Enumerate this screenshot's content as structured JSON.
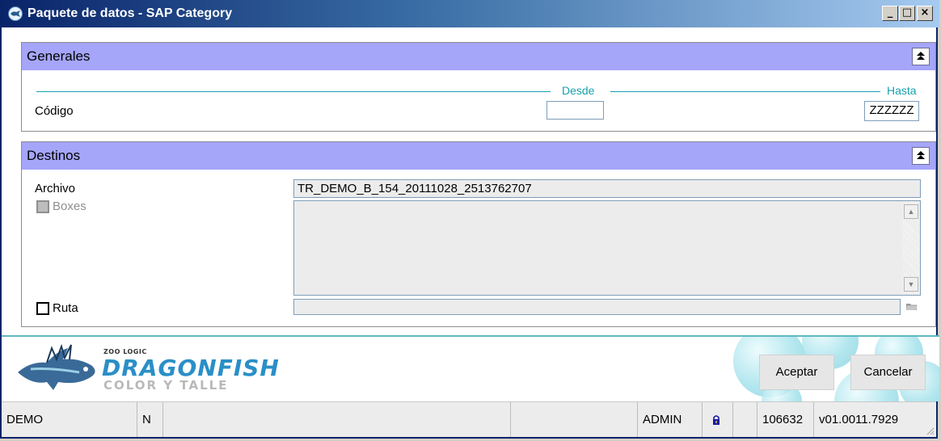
{
  "window": {
    "title": "Paquete de datos - SAP Category",
    "minimize_glyph": "_",
    "maximize_glyph": "□",
    "close_glyph": "×"
  },
  "generales": {
    "title": "Generales",
    "desde_label": "Desde",
    "hasta_label": "Hasta",
    "codigo_label": "Código",
    "codigo_desde_value": "",
    "codigo_hasta_value": "ZZZZZZ"
  },
  "destinos": {
    "title": "Destinos",
    "archivo_label": "Archivo",
    "archivo_value": "TR_DEMO_B_154_20111028_2513762707",
    "boxes_label": "Boxes",
    "boxes_checked": false,
    "ruta_label": "Ruta",
    "ruta_checked": false,
    "ruta_value": ""
  },
  "brand": {
    "company": "ZOO LOGIC",
    "product": "DRAGONFISH",
    "edition": "COLOR Y TALLE"
  },
  "buttons": {
    "accept": "Aceptar",
    "cancel": "Cancelar"
  },
  "statusbar": {
    "database": "DEMO",
    "mode": "N",
    "user": "ADMIN",
    "serial": "106632",
    "version": "v01.0011.7929"
  },
  "icons": {
    "app": "dragonfish-app-icon",
    "collapse": "collapse-up-icon",
    "folder": "folder-browse-icon",
    "lock": "lock-icon"
  },
  "colors": {
    "group_header": "#a5a5fa",
    "accent_line": "#17a0b0",
    "title_bar": "#0a246a"
  }
}
